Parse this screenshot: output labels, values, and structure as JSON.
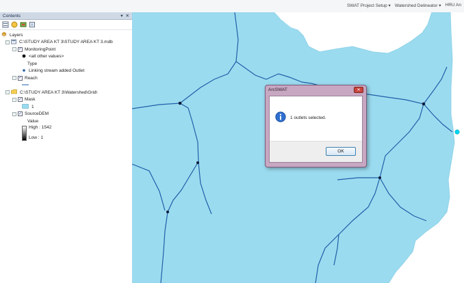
{
  "toolbar": {
    "menus": [
      "SWAT Project Setup ▾",
      "Watershed Delineator ▾",
      "HRU An"
    ]
  },
  "toc": {
    "title": "Contents",
    "controls": [
      "▾",
      "✕"
    ],
    "rows": [
      {
        "text": "Layers",
        "level": 0,
        "kind": "group",
        "icon": "layers-icon"
      },
      {
        "text": "C:\\STUDY AREA KT 3\\STUDY AREA KT 3.mdb",
        "level": 1,
        "kind": "database",
        "icon": "database-icon"
      },
      {
        "text": "MonitoringPoint",
        "level": 2,
        "kind": "layer",
        "checked": true
      },
      {
        "text": "<all other values>",
        "level": 3,
        "kind": "symbol",
        "icon": "black-dot-icon"
      },
      {
        "text": "Type",
        "level": 4,
        "kind": "label"
      },
      {
        "text": "Linking stream added Outlet",
        "level": 3,
        "kind": "symbol",
        "icon": "blue-dot-icon"
      },
      {
        "text": "Reach",
        "level": 2,
        "kind": "layer",
        "checked": true
      },
      {
        "text": "",
        "level": 3,
        "kind": "symbol",
        "icon": "line-icon"
      },
      {
        "text": "C:\\STUDY AREA KT 3\\Watershed\\Grid\\",
        "level": 1,
        "kind": "folder",
        "icon": "folder-icon"
      },
      {
        "text": "Mask",
        "level": 2,
        "kind": "layer",
        "checked": true
      },
      {
        "text": "1",
        "level": 3,
        "kind": "symbol",
        "icon": "blue-swatch-icon"
      },
      {
        "text": "SourceDEM",
        "level": 2,
        "kind": "layer",
        "checked": true
      },
      {
        "text": "Value",
        "level": 4,
        "kind": "label"
      },
      {
        "text": "High : 1542",
        "level": 4,
        "kind": "ramp-high",
        "icon": "ramp-icon"
      },
      {
        "text": "Low : 1",
        "level": 4,
        "kind": "ramp-low"
      }
    ]
  },
  "colors": {
    "water": "#9bdbef",
    "stream": "#1f5ea8",
    "outlet": "#0d1b3a",
    "added_outlet": "#00d8f0"
  },
  "dialog": {
    "title": "ArcSWAT",
    "close_label": "✕",
    "message": "1 outlets selected.",
    "ok_label": "OK",
    "icon": "info-icon"
  }
}
